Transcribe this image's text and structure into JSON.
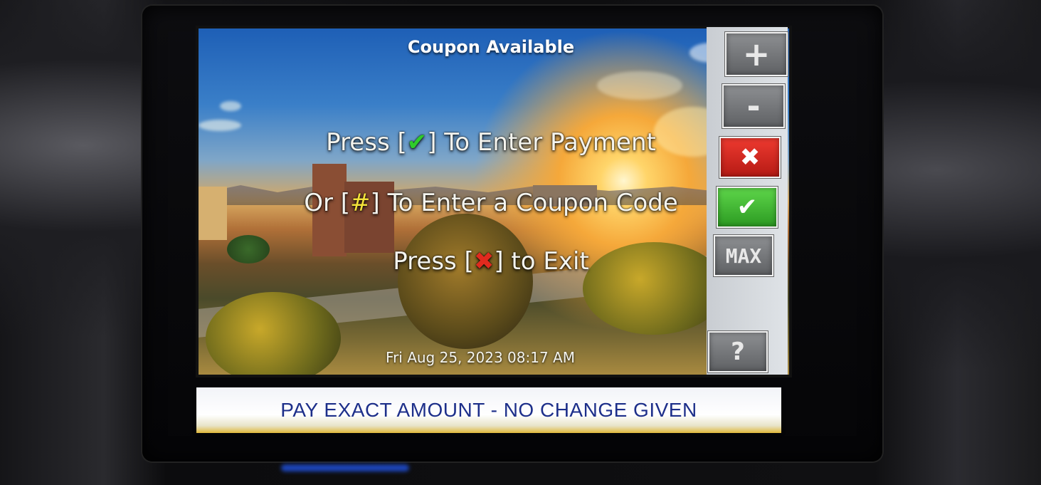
{
  "screen": {
    "title": "Coupon Available",
    "line1": {
      "prefix": "Press [",
      "symbol": "✔",
      "suffix": "] To Enter Payment"
    },
    "line2": {
      "prefix": "Or [",
      "symbol": "#",
      "suffix": "] To Enter a Coupon Code"
    },
    "line3": {
      "prefix": "Press [",
      "symbol": "✖",
      "suffix": "] to Exit"
    },
    "datetime": "Fri Aug 25, 2023 08:17 AM"
  },
  "keys": {
    "plus": "+",
    "minus": "-",
    "cancel": "✖",
    "confirm": "✔",
    "max": "MAX",
    "help": "?"
  },
  "sticker": {
    "text": "PAY EXACT AMOUNT - NO CHANGE GIVEN"
  },
  "colors": {
    "check": "#2fcb2a",
    "hash": "#f3e23a",
    "x": "#e02a1e",
    "sticker_text": "#1d2f8a"
  }
}
